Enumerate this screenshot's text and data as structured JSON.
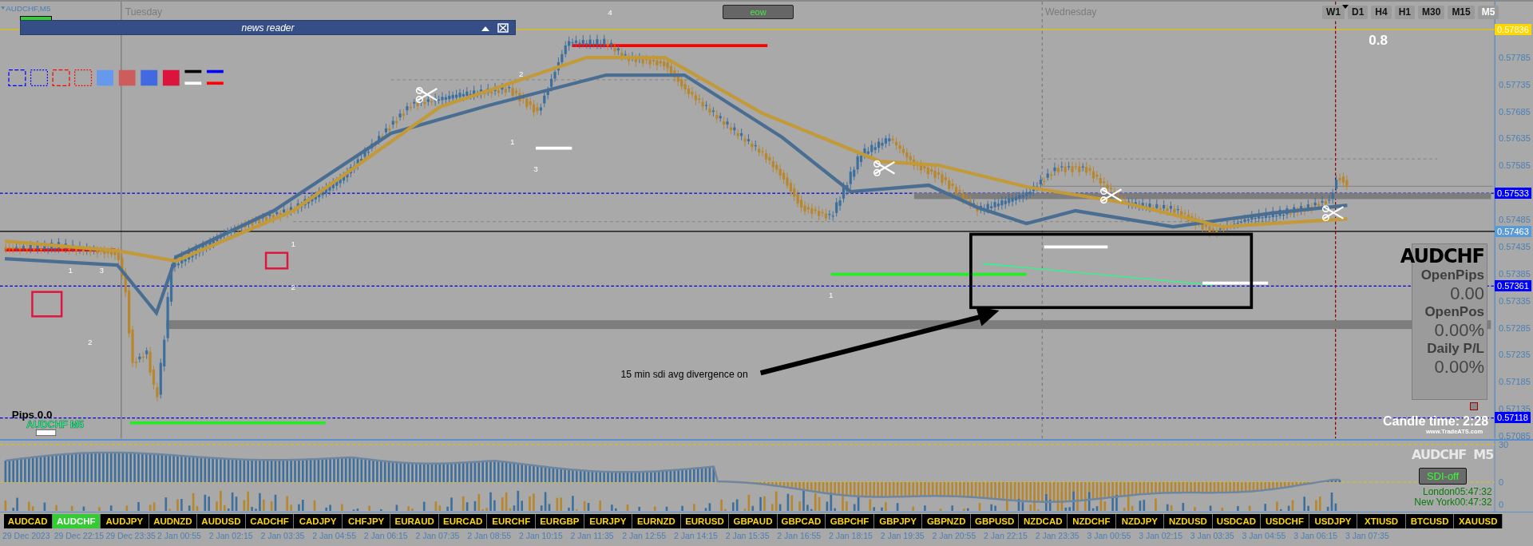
{
  "chart": {
    "symbol_label": "AUDCHF,M5",
    "day_labels": [
      "Tuesday",
      "Wednesday"
    ],
    "spread": "0.8",
    "wave_labels": [
      "4",
      "2",
      "1",
      "3",
      "1",
      "2",
      "1",
      "3",
      "2",
      "1"
    ],
    "annotation": "15 min sdi avg divergence on",
    "pips": "Pips 0.0",
    "chart_symbol": "AUDCHF M5"
  },
  "news_reader": {
    "title": "news reader"
  },
  "eow_button": "eow",
  "timeframes": [
    {
      "label": "W1",
      "selected": false
    },
    {
      "label": "D1",
      "selected": false
    },
    {
      "label": "H4",
      "selected": false
    },
    {
      "label": "H1",
      "selected": false
    },
    {
      "label": "M30",
      "selected": false
    },
    {
      "label": "M15",
      "selected": false
    },
    {
      "label": "M5",
      "selected": true
    }
  ],
  "price_axis": [
    {
      "label": "0.57836",
      "kind": "marker",
      "color": "#ffd700"
    },
    {
      "label": "0.57785",
      "kind": "tick"
    },
    {
      "label": "0.57735",
      "kind": "tick"
    },
    {
      "label": "0.57685",
      "kind": "tick"
    },
    {
      "label": "0.57635",
      "kind": "tick"
    },
    {
      "label": "0.57585",
      "kind": "tick"
    },
    {
      "label": "0.57533",
      "kind": "marker",
      "color": "#0000ff"
    },
    {
      "label": "0.57485",
      "kind": "tick"
    },
    {
      "label": "0.57463",
      "kind": "marker",
      "color": "#5b9bd5"
    },
    {
      "label": "0.57435",
      "kind": "tick"
    },
    {
      "label": "0.57385",
      "kind": "tick"
    },
    {
      "label": "0.57361",
      "kind": "marker",
      "color": "#0000ff"
    },
    {
      "label": "0.57335",
      "kind": "tick"
    },
    {
      "label": "0.57285",
      "kind": "tick"
    },
    {
      "label": "0.57235",
      "kind": "tick"
    },
    {
      "label": "0.57185",
      "kind": "tick"
    },
    {
      "label": "0.57135",
      "kind": "tick"
    },
    {
      "label": "0.57118",
      "kind": "marker",
      "color": "#0000ff"
    },
    {
      "label": "0.57085",
      "kind": "tick"
    }
  ],
  "info_panel": {
    "symbol": "AUDCHF",
    "rows": [
      {
        "label": "OpenPips",
        "value": "0.00"
      },
      {
        "label": "OpenPos",
        "value": "0.00%"
      },
      {
        "label": "Daily P/L",
        "value": "0.00%"
      }
    ]
  },
  "candle_time": {
    "label": "Candle time:",
    "value": "2:28"
  },
  "website": "www.TradeATS.com",
  "indicator": {
    "title": "AUDCHF  M5",
    "toggle": "SDI-off",
    "axis": [
      "30",
      "0",
      "0"
    ],
    "sessions": [
      {
        "city": "London",
        "time": "05:47:32"
      },
      {
        "city": "New York",
        "time": "00:47:32"
      }
    ]
  },
  "symbols": [
    {
      "label": "AUDCAD",
      "selected": false
    },
    {
      "label": "AUDCHF",
      "selected": true
    },
    {
      "label": "AUDJPY",
      "selected": false
    },
    {
      "label": "AUDNZD",
      "selected": false
    },
    {
      "label": "AUDUSD",
      "selected": false
    },
    {
      "label": "CADCHF",
      "selected": false
    },
    {
      "label": "CADJPY",
      "selected": false
    },
    {
      "label": "CHFJPY",
      "selected": false
    },
    {
      "label": "EURAUD",
      "selected": false
    },
    {
      "label": "EURCAD",
      "selected": false
    },
    {
      "label": "EURCHF",
      "selected": false
    },
    {
      "label": "EURGBP",
      "selected": false
    },
    {
      "label": "EURJPY",
      "selected": false
    },
    {
      "label": "EURNZD",
      "selected": false
    },
    {
      "label": "EURUSD",
      "selected": false
    },
    {
      "label": "GBPAUD",
      "selected": false
    },
    {
      "label": "GBPCAD",
      "selected": false
    },
    {
      "label": "GBPCHF",
      "selected": false
    },
    {
      "label": "GBPJPY",
      "selected": false
    },
    {
      "label": "GBPNZD",
      "selected": false
    },
    {
      "label": "GBPUSD",
      "selected": false
    },
    {
      "label": "NZDCAD",
      "selected": false
    },
    {
      "label": "NZDCHF",
      "selected": false
    },
    {
      "label": "NZDJPY",
      "selected": false
    },
    {
      "label": "NZDUSD",
      "selected": false
    },
    {
      "label": "USDCAD",
      "selected": false
    },
    {
      "label": "USDCHF",
      "selected": false
    },
    {
      "label": "USDJPY",
      "selected": false
    },
    {
      "label": "XTIUSD",
      "selected": false
    },
    {
      "label": "BTCUSD",
      "selected": false
    },
    {
      "label": "XAUUSD",
      "selected": false
    }
  ],
  "dates": [
    "29 Dec 2023",
    "29 Dec 22:15",
    "29 Dec 23:35",
    "2 Jan 00:55",
    "2 Jan 02:15",
    "2 Jan 03:35",
    "2 Jan 04:55",
    "2 Jan 06:15",
    "2 Jan 07:35",
    "2 Jan 08:55",
    "2 Jan 10:15",
    "2 Jan 11:35",
    "2 Jan 12:55",
    "2 Jan 14:15",
    "2 Jan 15:35",
    "2 Jan 16:55",
    "2 Jan 18:15",
    "2 Jan 19:35",
    "2 Jan 20:55",
    "2 Jan 22:15",
    "2 Jan 23:35",
    "3 Jan 00:55",
    "3 Jan 02:15",
    "3 Jan 03:35",
    "3 Jan 04:55",
    "3 Jan 06:15",
    "3 Jan 07:35"
  ]
}
